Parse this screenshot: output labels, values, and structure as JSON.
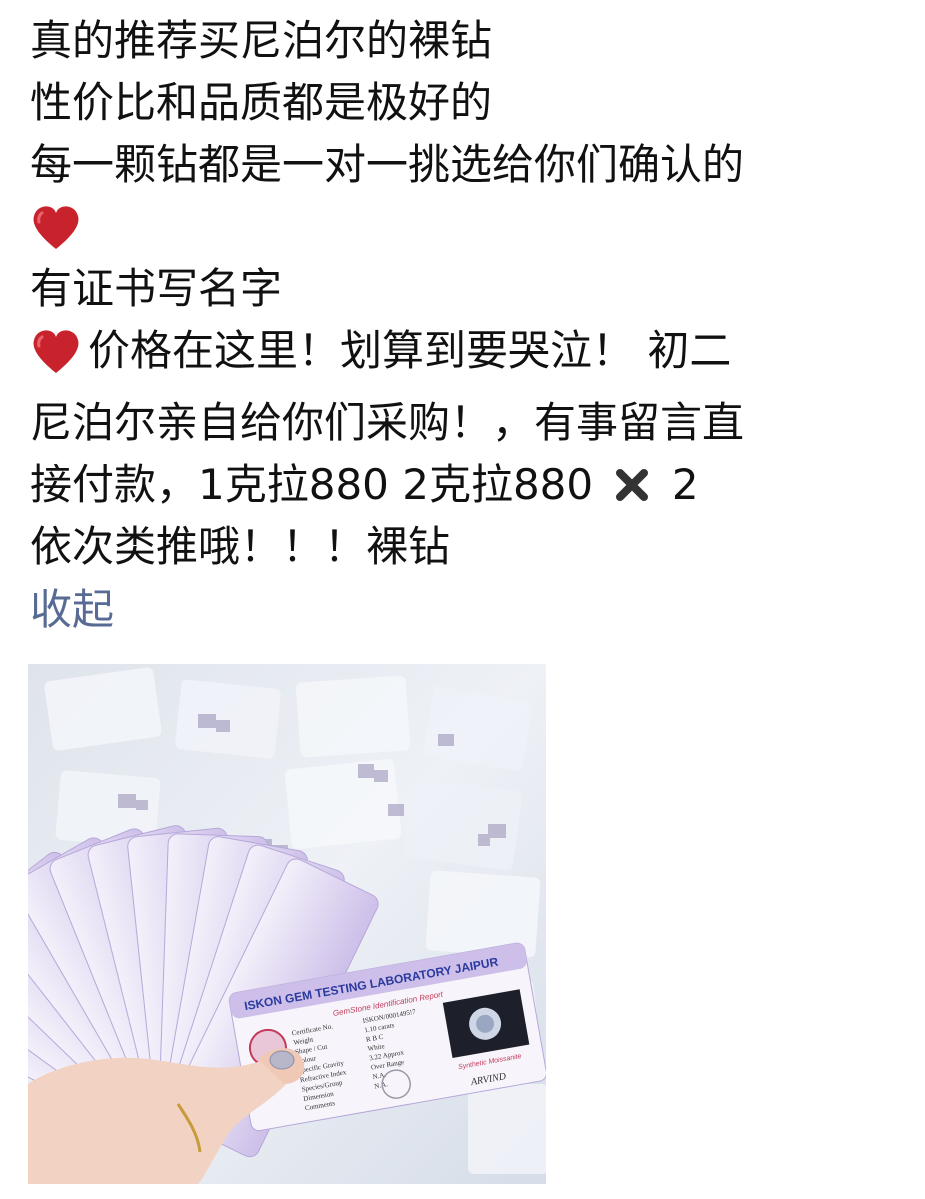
{
  "post": {
    "lines": [
      "真的推荐买尼泊尔的裸钻",
      "性价比和品质都是极好的",
      "每一颗钻都是一对一挑选给你们确认的",
      "有证书写名字",
      "价格在这里！划算到要哭泣！ 初二",
      "尼泊尔亲自给你们采购！，有事留言直",
      "接付款，1克拉880 2克拉880",
      "2",
      "依次类推哦！！！裸钻"
    ],
    "emoji": {
      "heart": "red-heart",
      "multiply": "heavy-multiplication-x"
    },
    "collapse_label": "收起"
  },
  "photo": {
    "card_title": "ISKON GEM TESTING LABORATORY JAIPUR",
    "report_label": "GemStone Identification Report",
    "fields": [
      {
        "label": "Certificate No.",
        "value": "ISKON/0001495!7"
      },
      {
        "label": "Weight",
        "value": "1.10 carats"
      },
      {
        "label": "Shape / Cut",
        "value": "R B C"
      },
      {
        "label": "Colour",
        "value": "White"
      },
      {
        "label": "Specific Gravity",
        "value": "3.22 Approx"
      },
      {
        "label": "Refractive Index",
        "value": "Over Range"
      },
      {
        "label": "Species/Group",
        "value": "N.A."
      },
      {
        "label": "Dimension",
        "value": "N.A."
      },
      {
        "label": "Comments",
        "value": ""
      }
    ],
    "stone_label": "Synthetic Moissanite",
    "signature": "ARVIND",
    "colors": {
      "card_purple": "#c9b8e6",
      "card_blue_text": "#2a3a9e",
      "card_white": "#f7f5fb",
      "bg": "#e4e9f1"
    }
  }
}
